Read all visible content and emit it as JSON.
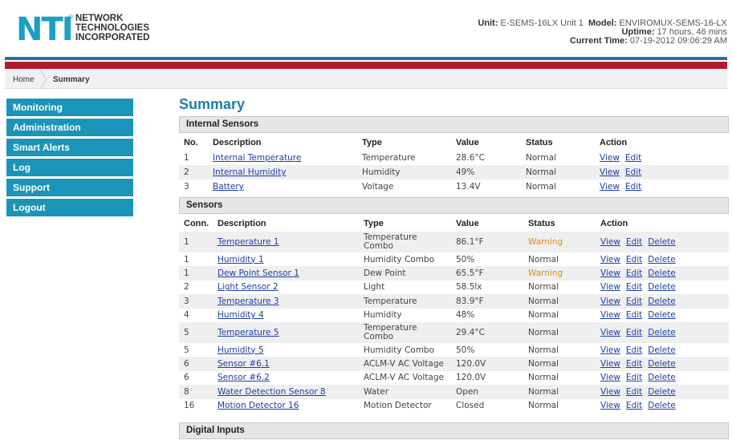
{
  "company": {
    "logo_letters": "NTI",
    "name_lines": [
      "NETWORK",
      "TECHNOLOGIES",
      "INCORPORATED"
    ]
  },
  "unit_info": {
    "unit_label": "Unit:",
    "unit_value": "E-SEMS-16LX Unit 1",
    "model_label": "Model:",
    "model_value": "ENVIROMUX-SEMS-16-LX",
    "uptime_label": "Uptime:",
    "uptime_value": "17 hours, 46 mins",
    "time_label": "Current Time:",
    "time_value": "07-19-2012 09:06:29 AM"
  },
  "breadcrumb": {
    "home": "Home",
    "current": "Summary"
  },
  "nav": [
    "Monitoring",
    "Administration",
    "Smart Alerts",
    "Log",
    "Support",
    "Logout"
  ],
  "page_title": "Summary",
  "internal": {
    "title": "Internal Sensors",
    "headers": [
      "No.",
      "Description",
      "Type",
      "Value",
      "Status",
      "Action"
    ],
    "rows": [
      {
        "no": "1",
        "desc": "Internal Temperature",
        "type": "Temperature",
        "value": "28.6°C",
        "status": "Normal"
      },
      {
        "no": "2",
        "desc": "Internal Humidity",
        "type": "Humidity",
        "value": "49%",
        "status": "Normal"
      },
      {
        "no": "3",
        "desc": "Battery",
        "type": "Voltage",
        "value": "13.4V",
        "status": "Normal"
      }
    ]
  },
  "sensors": {
    "title": "Sensors",
    "headers": [
      "Conn.",
      "Description",
      "Type",
      "Value",
      "Status",
      "Action"
    ],
    "rows": [
      {
        "conn": "1",
        "desc": "Temperature 1",
        "type": "Temperature Combo",
        "value": "86.1°F",
        "status": "Warning"
      },
      {
        "conn": "1",
        "desc": "Humidity 1",
        "type": "Humidity Combo",
        "value": "50%",
        "status": "Normal"
      },
      {
        "conn": "1",
        "desc": "Dew Point Sensor 1",
        "type": "Dew Point",
        "value": "65.5°F",
        "status": "Warning"
      },
      {
        "conn": "2",
        "desc": "Light Sensor 2",
        "type": "Light",
        "value": "58.5lx",
        "status": "Normal"
      },
      {
        "conn": "3",
        "desc": "Temperature 3",
        "type": "Temperature",
        "value": "83.9°F",
        "status": "Normal"
      },
      {
        "conn": "4",
        "desc": "Humidity 4",
        "type": "Humidity",
        "value": "48%",
        "status": "Normal"
      },
      {
        "conn": "5",
        "desc": "Temperature 5",
        "type": "Temperature Combo",
        "value": "29.4°C",
        "status": "Normal"
      },
      {
        "conn": "5",
        "desc": "Humidity 5",
        "type": "Humidity Combo",
        "value": "50%",
        "status": "Normal"
      },
      {
        "conn": "6",
        "desc": "Sensor #6.1",
        "type": "ACLM-V AC Voltage",
        "value": "120.0V",
        "status": "Normal"
      },
      {
        "conn": "6",
        "desc": "Sensor #6.2",
        "type": "ACLM-V AC Voltage",
        "value": "120.0V",
        "status": "Normal"
      },
      {
        "conn": "8",
        "desc": "Water Detection Sensor 8",
        "type": "Water",
        "value": "Open",
        "status": "Normal"
      },
      {
        "conn": "16",
        "desc": "Motion Detector 16",
        "type": "Motion Detector",
        "value": "Closed",
        "status": "Normal"
      }
    ]
  },
  "digital": {
    "title": "Digital Inputs"
  },
  "actions": {
    "view": "View",
    "edit": "Edit",
    "delete": "Delete"
  },
  "colors": {
    "nav_bg": "#1a94b8",
    "title": "#1d7fa8",
    "link": "#1c3fa8",
    "warning": "#e08a1a",
    "stripe_blue": "#2a6ea8",
    "stripe_red": "#b01c2e"
  }
}
